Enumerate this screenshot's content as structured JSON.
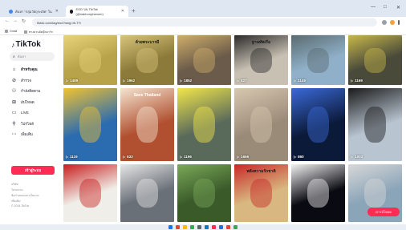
{
  "browser": {
    "tabs": [
      {
        "title": "ค้นหา \"กลุ่มวัตถุระเบิด\" ใน"
      },
      {
        "title": "EOD บน TikTok (@nakhonphanom)"
      }
    ],
    "new_tab": "+",
    "window_controls": [
      "—",
      "□",
      "✕"
    ],
    "nav": {
      "back": "←",
      "forward": "→",
      "reload": "↻"
    },
    "url": "tiktok.com/tag/eod?lang=th-TH",
    "bookmarks": [
      {
        "label": "Gmail"
      },
      {
        "label": "ทางด่วนลัดบุ๊คมาร์ก"
      }
    ]
  },
  "sidebar": {
    "logo": "TikTok",
    "search_placeholder": "ค้นหา",
    "nav_items": [
      {
        "label": "สำหรับคุณ",
        "icon": "home-icon",
        "glyph": "⌂"
      },
      {
        "label": "สำรวจ",
        "icon": "compass-icon",
        "glyph": "⊘"
      },
      {
        "label": "กำลังติดตาม",
        "icon": "following-icon",
        "glyph": "⚇"
      },
      {
        "label": "อัปโหลด",
        "icon": "upload-icon",
        "glyph": "⊞"
      },
      {
        "label": "LIVE",
        "icon": "live-icon",
        "glyph": "▭"
      },
      {
        "label": "โปรไฟล์",
        "icon": "profile-icon",
        "glyph": "⚲"
      },
      {
        "label": "เพิ่มเติม",
        "icon": "more-icon",
        "glyph": "⋯"
      }
    ],
    "login_label": "เข้าสู่ระบบ",
    "footer_links": [
      "บริษัท",
      "โปรแกรม",
      "ข้อกำหนดและนโยบาย",
      "เพิ่มเติม",
      "© 2024 TikTok"
    ]
  },
  "videos": [
    {
      "views": "1489",
      "bg": "#b8a24a",
      "accent": "#e8d27a",
      "overlay": ""
    },
    {
      "views": "1962",
      "bg": "#8c7a3a",
      "accent": "#d7c47a",
      "overlay": "ด้วยพระบารมี"
    },
    {
      "views": "1852",
      "bg": "#6b5b4a",
      "accent": "#cfae6a",
      "overlay": ""
    },
    {
      "views": "827",
      "bg": "#c8c0b2",
      "accent": "#2a2a2a",
      "overlay": "ฐานทัพเรือ"
    },
    {
      "views": "1149",
      "bg": "#8fb0c8",
      "accent": "#5a6a70",
      "overlay": ""
    },
    {
      "views": "1169",
      "bg": "#4a4a3a",
      "accent": "#c8b84a",
      "overlay": ""
    },
    {
      "views": "1119",
      "bg": "#2b6cb0",
      "accent": "#f2c230",
      "overlay": ""
    },
    {
      "views": "633",
      "bg": "#b05030",
      "accent": "#f4e4d0",
      "overlay": "Save Thailand"
    },
    {
      "views": "1196",
      "bg": "#5a6a5a",
      "accent": "#f2e64a",
      "overlay": ""
    },
    {
      "views": "1666",
      "bg": "#9a8a78",
      "accent": "#d8c8b0",
      "overlay": ""
    },
    {
      "views": "860",
      "bg": "#0c1a3a",
      "accent": "#3a6ad8",
      "overlay": ""
    },
    {
      "views": "1003",
      "bg": "#b8c4d0",
      "accent": "#1a1a1a",
      "overlay": ""
    },
    {
      "views": "",
      "bg": "#f0eee8",
      "accent": "#c81e1e",
      "overlay": ""
    },
    {
      "views": "",
      "bg": "#6a7078",
      "accent": "#e6e6e6",
      "overlay": ""
    },
    {
      "views": "",
      "bg": "#3a5a2a",
      "accent": "#7aa858",
      "overlay": ""
    },
    {
      "views": "",
      "bg": "#d8b880",
      "accent": "#c82828",
      "overlay": "พลังความรักชาติ"
    },
    {
      "views": "",
      "bg": "#0a0a12",
      "accent": "#f2f2f2",
      "overlay": ""
    },
    {
      "views": "",
      "bg": "#8aa4b8",
      "accent": "#d8d8d8",
      "overlay": ""
    }
  ],
  "float_button": "ดาวน์โหลด",
  "taskbar_colors": [
    "#1a73e8",
    "#ea4335",
    "#fbbc04",
    "#34a853",
    "#5f6368",
    "#0078d4",
    "#fe2c55",
    "#1a73e8",
    "#ea4335",
    "#34a853"
  ]
}
